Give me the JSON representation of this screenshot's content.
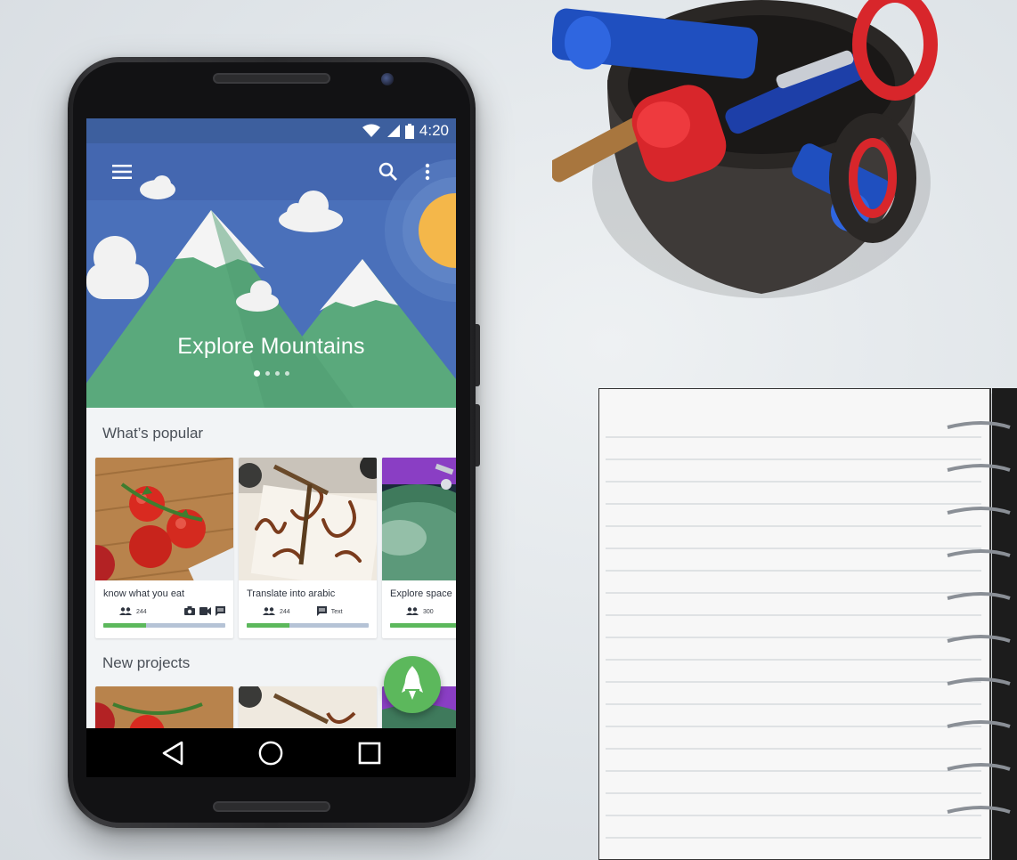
{
  "status_bar": {
    "time": "4:20",
    "icons": [
      "wifi-icon",
      "signal-icon",
      "battery-icon"
    ]
  },
  "app_bar": {
    "icons": [
      "menu-icon",
      "search-icon",
      "more-vert-icon"
    ]
  },
  "hero": {
    "title": "Explore Mountains",
    "pager": {
      "pages": 4,
      "active": 0
    }
  },
  "sections": {
    "popular_title": "What’s popular",
    "new_title": "New projects"
  },
  "popular_cards": [
    {
      "label": "know what you eat",
      "members": "244",
      "media_icons": [
        "camera-icon",
        "video-icon",
        "message-icon"
      ],
      "progress": 0.35,
      "image": "tomatoes"
    },
    {
      "label": "Translate into arabic",
      "members": "244",
      "media_label": "Text",
      "media_icons": [
        "message-icon"
      ],
      "progress": 0.35,
      "image": "calligraphy"
    },
    {
      "label": "Explore space",
      "members": "300",
      "progress": 0.9,
      "image": "space"
    }
  ],
  "fab": {
    "icon": "rocket-icon"
  },
  "nav_bar": {
    "icons": [
      "back-icon",
      "home-icon",
      "recents-icon"
    ]
  },
  "colors": {
    "primary": "#4a70ba",
    "status_bar": "#3d5f9e",
    "accent_green": "#5cb85c",
    "mountain_green": "#5aa97c",
    "sun": "#f4b74a"
  }
}
